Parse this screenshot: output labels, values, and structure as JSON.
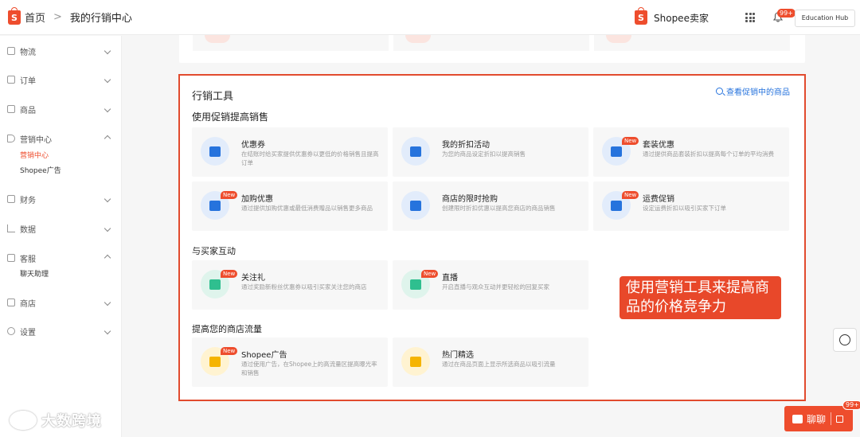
{
  "header": {
    "home": "首页",
    "separator": ">",
    "current": "我的行销中心",
    "brand": "Shopee卖家",
    "notif_badge": "99+",
    "education": "Education Hub"
  },
  "sidebar": {
    "items": [
      {
        "label": "物流",
        "expanded": false
      },
      {
        "label": "订单",
        "expanded": false
      },
      {
        "label": "商品",
        "expanded": false
      },
      {
        "label": "营销中心",
        "expanded": true,
        "subs": [
          "营销中心",
          "Shopee广告"
        ]
      },
      {
        "label": "财务",
        "expanded": false
      },
      {
        "label": "数据",
        "expanded": false
      },
      {
        "label": "客服",
        "expanded": true,
        "subs": [
          "聊天助理"
        ]
      },
      {
        "label": "商店",
        "expanded": false
      },
      {
        "label": "设置",
        "expanded": false
      }
    ]
  },
  "main": {
    "title": "行销工具",
    "view_link": "查看促销中的商品",
    "sections": [
      {
        "title": "使用促销提高销售",
        "tiles": [
          {
            "title": "优惠券",
            "desc": "在结账时给买家提供优惠券以更低的价格销售且提高订单",
            "new": false,
            "icon": "ticket-icon",
            "color": "#2673dd"
          },
          {
            "title": "我的折扣活动",
            "desc": "为您的商品设定折扣以提高销售",
            "new": false,
            "icon": "discount-tag-icon",
            "color": "#2673dd"
          },
          {
            "title": "套装优惠",
            "desc": "通过提供商品套装折扣以提高每个订单的平均消费",
            "new": true,
            "icon": "bundle-bag-icon",
            "color": "#2673dd"
          },
          {
            "title": "加购优惠",
            "desc": "通过提供加购优惠或最低消费赠品以销售更多商品",
            "new": true,
            "icon": "add-on-icon",
            "color": "#2673dd"
          },
          {
            "title": "商店的限时抢购",
            "desc": "创建限时折扣优惠以提高您商店的商品销售",
            "new": false,
            "icon": "flash-sale-icon",
            "color": "#2673dd"
          },
          {
            "title": "运费促销",
            "desc": "设定运费折扣以吸引买家下订单",
            "new": true,
            "icon": "shipping-truck-icon",
            "color": "#2673dd"
          }
        ]
      },
      {
        "title": "与买家互动",
        "tiles": [
          {
            "title": "关注礼",
            "desc": "通过奖励新粉丝优惠券以吸引买家关注您的商店",
            "new": true,
            "icon": "gift-icon",
            "color": "#2fbf8f"
          },
          {
            "title": "直播",
            "desc": "开启直播与观众互动并更轻松的回复买家",
            "new": true,
            "icon": "live-video-icon",
            "color": "#2fbf8f"
          }
        ]
      },
      {
        "title": "提高您的商店流量",
        "tiles": [
          {
            "title": "Shopee广告",
            "desc": "通过使用广告，在Shopee上的高流量区提高曝光率和销售",
            "new": true,
            "icon": "ads-icon",
            "color": "#f5b400"
          },
          {
            "title": "热门精选",
            "desc": "通过在商品页面上显示所选商品以吸引流量",
            "new": false,
            "icon": "top-picks-icon",
            "color": "#f5b400"
          }
        ]
      }
    ]
  },
  "caption": "使用营销工具来提高商品的价格竞争力",
  "chat": {
    "label": "聊聊",
    "badge": "99+"
  },
  "watermark": "大数跨境",
  "new_badge": "New"
}
